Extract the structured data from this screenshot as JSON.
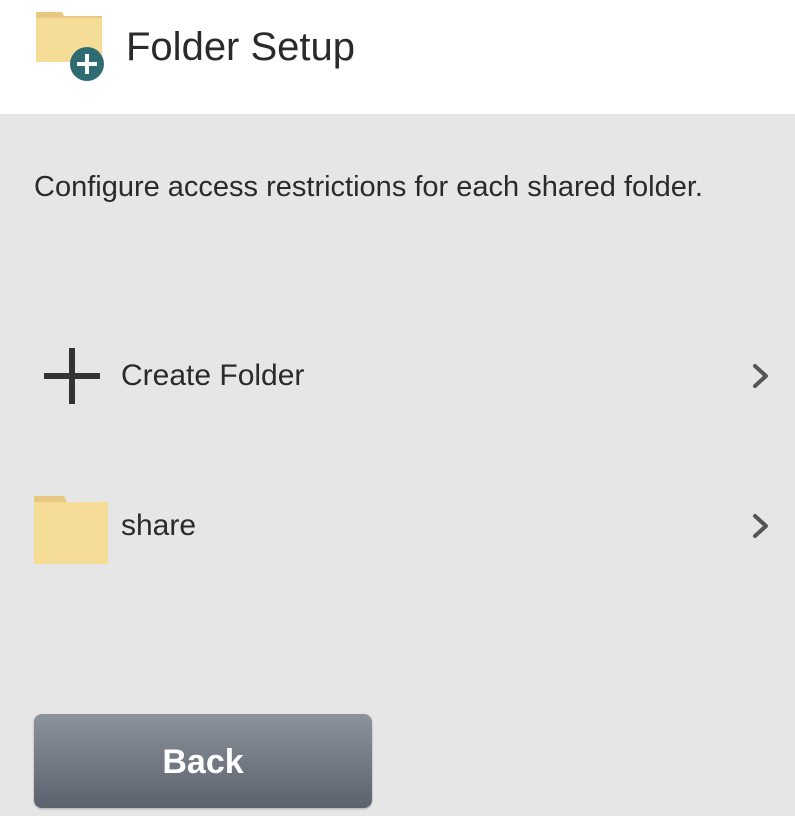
{
  "header": {
    "title": "Folder Setup",
    "icon": "folder-add-icon"
  },
  "main": {
    "description": "Configure access restrictions for each shared folder.",
    "items": [
      {
        "label": "Create Folder",
        "icon": "plus-icon"
      },
      {
        "label": "share",
        "icon": "folder-icon"
      }
    ],
    "back_label": "Back"
  },
  "colors": {
    "panel_background": "#e6e6e6",
    "folder": "#f6dd97",
    "badge": "#2f6c72",
    "button_top": "#8d939c",
    "button_bottom": "#5b626d"
  }
}
